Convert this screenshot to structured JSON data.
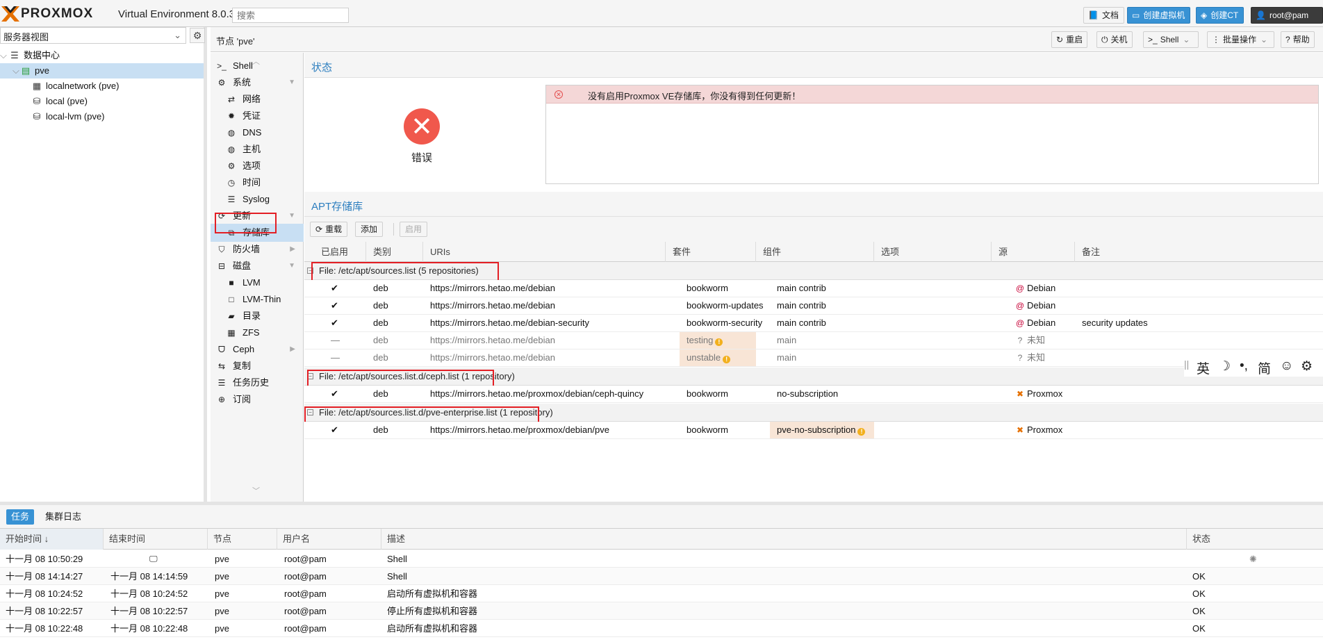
{
  "topbar": {
    "logo_text": "PROXMOX",
    "version": "Virtual Environment 8.0.3",
    "search_placeholder": "搜索",
    "docs_label": "文档",
    "create_vm_label": "创建虚拟机",
    "create_ct_label": "创建CT",
    "user_label": "root@pam"
  },
  "tree": {
    "view_label": "服务器视图",
    "datacenter": "数据中心",
    "node": "pve",
    "items": [
      "localnetwork (pve)",
      "local (pve)",
      "local-lvm (pve)"
    ]
  },
  "nodebar": {
    "title": "节点 'pve'",
    "reboot": "重启",
    "shutdown": "关机",
    "shell": "Shell",
    "bulk": "批量操作",
    "help": "帮助"
  },
  "menu": {
    "shell": "Shell",
    "system": "系统",
    "network": "网络",
    "certs": "凭证",
    "dns": "DNS",
    "hosts": "主机",
    "options": "选项",
    "time": "时间",
    "syslog": "Syslog",
    "updates": "更新",
    "repos": "存储库",
    "firewall": "防火墙",
    "disks": "磁盘",
    "lvm": "LVM",
    "lvmthin": "LVM-Thin",
    "directory": "目录",
    "zfs": "ZFS",
    "ceph": "Ceph",
    "replication": "复制",
    "task_history": "任务历史",
    "subscription": "订阅"
  },
  "status": {
    "title": "状态",
    "state": "错误",
    "message": "没有启用Proxmox VE存储库，你没有得到任何更新！"
  },
  "apt": {
    "title": "APT存储库",
    "reload": "重载",
    "add": "添加",
    "enable": "启用",
    "columns": [
      "已启用",
      "类别",
      "URIs",
      "套件",
      "组件",
      "选项",
      "源",
      "备注"
    ],
    "groups": [
      {
        "title": "File: /etc/apt/sources.list (5 repositories)",
        "rows": [
          {
            "enabled": "✔",
            "type": "deb",
            "uri": "https://mirrors.hetao.me/debian",
            "suite": "bookworm",
            "comp": "main contrib",
            "origin": "Debian",
            "note": ""
          },
          {
            "enabled": "✔",
            "type": "deb",
            "uri": "https://mirrors.hetao.me/debian",
            "suite": "bookworm-updates",
            "comp": "main contrib",
            "origin": "Debian",
            "note": ""
          },
          {
            "enabled": "✔",
            "type": "deb",
            "uri": "https://mirrors.hetao.me/debian-security",
            "suite": "bookworm-security",
            "comp": "main contrib",
            "origin": "Debian",
            "note": "security updates"
          },
          {
            "enabled": "—",
            "type": "deb",
            "uri": "https://mirrors.hetao.me/debian",
            "suite": "testing",
            "comp": "main",
            "origin": "未知",
            "note": ""
          },
          {
            "enabled": "—",
            "type": "deb",
            "uri": "https://mirrors.hetao.me/debian",
            "suite": "unstable",
            "comp": "main",
            "origin": "未知",
            "note": ""
          }
        ]
      },
      {
        "title": "File: /etc/apt/sources.list.d/ceph.list (1 repository)",
        "rows": [
          {
            "enabled": "✔",
            "type": "deb",
            "uri": "https://mirrors.hetao.me/proxmox/debian/ceph-quincy",
            "suite": "bookworm",
            "comp": "no-subscription",
            "origin": "Proxmox",
            "note": ""
          }
        ]
      },
      {
        "title": "File: /etc/apt/sources.list.d/pve-enterprise.list (1 repository)",
        "rows": [
          {
            "enabled": "✔",
            "type": "deb",
            "uri": "https://mirrors.hetao.me/proxmox/debian/pve",
            "suite": "bookworm",
            "comp": "pve-no-subscription",
            "origin": "Proxmox",
            "note": ""
          }
        ]
      }
    ]
  },
  "ime": {
    "lang": "英",
    "moon": "☽",
    "punct": "•,",
    "simp": "简",
    "emoji": "☺",
    "gear": "⚙"
  },
  "tasks": {
    "tab_tasks": "任务",
    "tab_cluster_log": "集群日志",
    "columns": [
      "开始时间 ↓",
      "结束时间",
      "节点",
      "用户名",
      "描述",
      "状态"
    ],
    "rows": [
      {
        "start": "十一月 08 10:50:29",
        "end": "",
        "node": "pve",
        "user": "root@pam",
        "desc": "Shell",
        "status": ""
      },
      {
        "start": "十一月 08 14:14:27",
        "end": "十一月 08 14:14:59",
        "node": "pve",
        "user": "root@pam",
        "desc": "Shell",
        "status": "OK"
      },
      {
        "start": "十一月 08 10:24:52",
        "end": "十一月 08 10:24:52",
        "node": "pve",
        "user": "root@pam",
        "desc": "启动所有虚拟机和容器",
        "status": "OK"
      },
      {
        "start": "十一月 08 10:22:57",
        "end": "十一月 08 10:22:57",
        "node": "pve",
        "user": "root@pam",
        "desc": "停止所有虚拟机和容器",
        "status": "OK"
      },
      {
        "start": "十一月 08 10:22:48",
        "end": "十一月 08 10:22:48",
        "node": "pve",
        "user": "root@pam",
        "desc": "启动所有虚拟机和容器",
        "status": "OK"
      }
    ]
  }
}
